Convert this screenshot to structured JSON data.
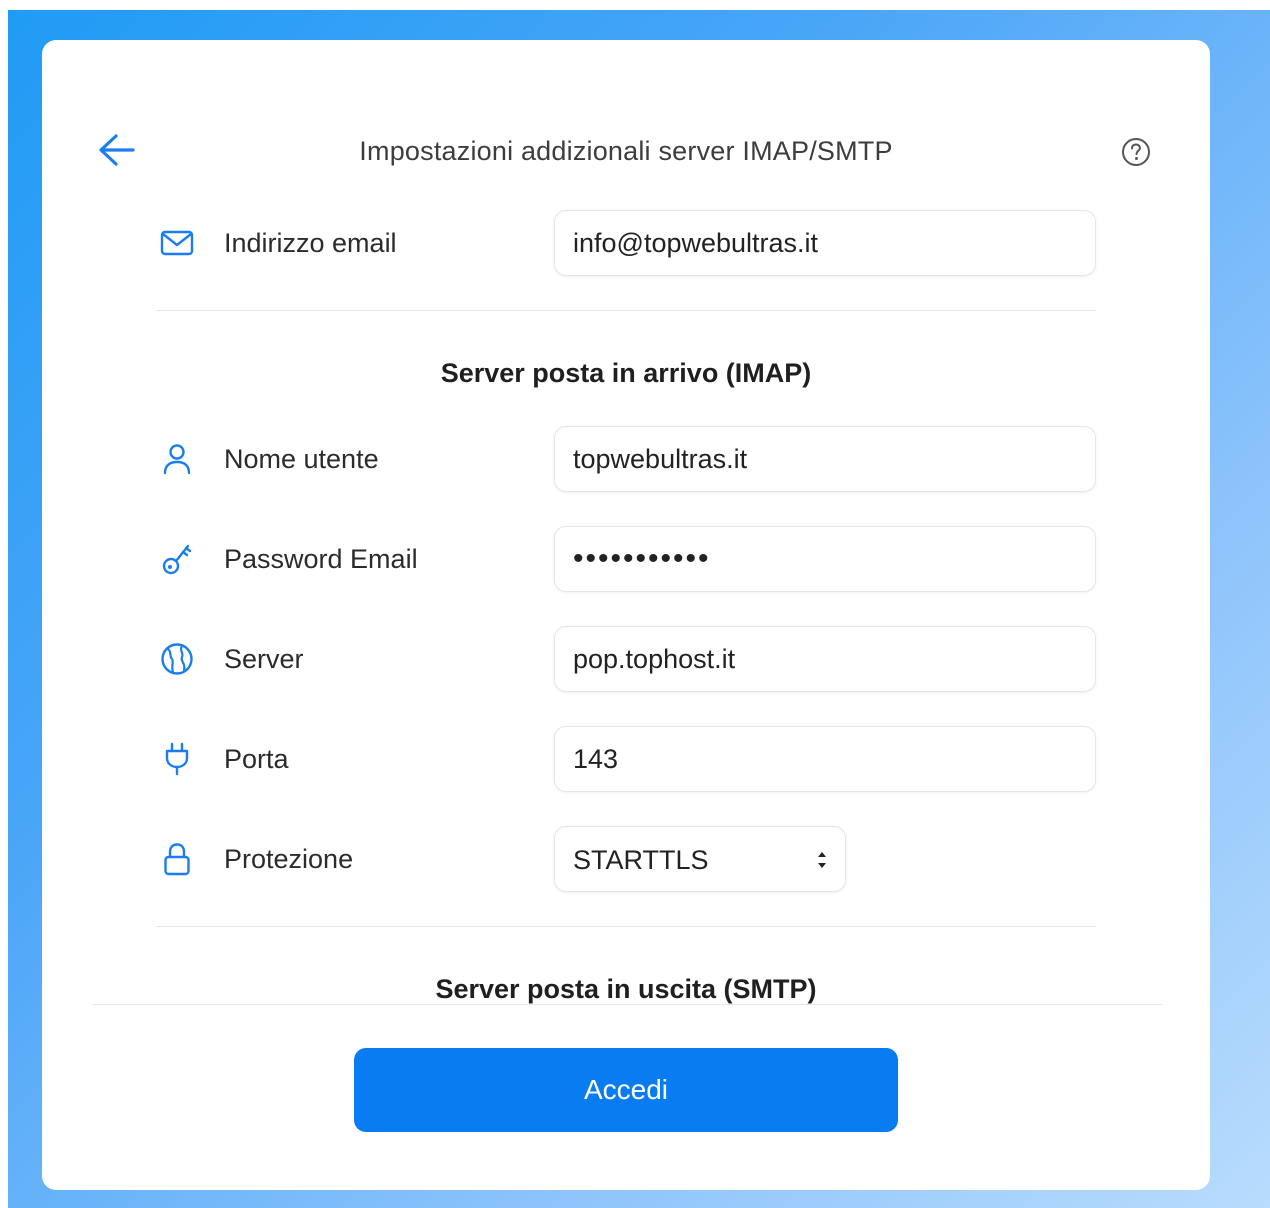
{
  "header": {
    "title": "Impostazioni addizionali server IMAP/SMTP",
    "back_icon": "arrow-left-icon",
    "help_icon": "help-circle-icon"
  },
  "email": {
    "label": "Indirizzo email",
    "value": "info@topwebultras.it",
    "icon": "mail-icon"
  },
  "imap": {
    "section_title": "Server posta in arrivo (IMAP)",
    "username": {
      "label": "Nome utente",
      "value": "topwebultras.it",
      "icon": "user-icon"
    },
    "password": {
      "label": "Password Email",
      "value": "•••••••••••",
      "icon": "key-icon"
    },
    "server": {
      "label": "Server",
      "value": "pop.tophost.it",
      "icon": "globe-icon"
    },
    "port": {
      "label": "Porta",
      "value": "143",
      "icon": "plug-icon"
    },
    "security": {
      "label": "Protezione",
      "value": "STARTTLS",
      "icon": "lock-icon"
    }
  },
  "smtp": {
    "section_title": "Server posta in uscita (SMTP)"
  },
  "footer": {
    "submit_label": "Accedi"
  },
  "colors": {
    "accent": "#0a7cf2",
    "icon": "#1a7ef0",
    "text": "#2b2b2b"
  }
}
